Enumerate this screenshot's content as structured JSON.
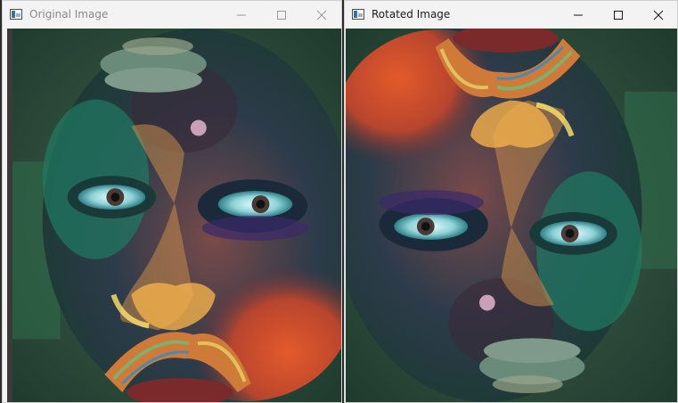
{
  "windows": [
    {
      "title": "Original Image",
      "icon": "opencv-window-icon",
      "state": "inactive",
      "controls": [
        "minimize-icon",
        "maximize-icon",
        "close-icon"
      ]
    },
    {
      "title": "Rotated Image",
      "icon": "opencv-window-icon",
      "state": "active",
      "controls": [
        "minimize-icon",
        "maximize-icon",
        "close-icon"
      ]
    }
  ],
  "colors": {
    "titlebar": "#f3f3f3",
    "title_inactive": "#8a8a8a",
    "title_active": "#1a1a1a",
    "desktop": "#2b2b2b"
  }
}
